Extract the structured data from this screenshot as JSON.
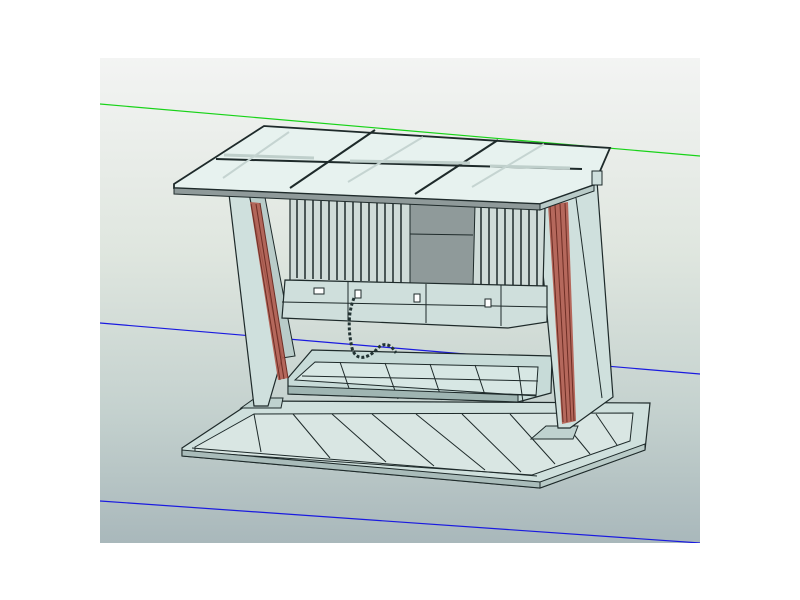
{
  "app": {
    "title": "",
    "view": {
      "background_top": "#f3f4f3",
      "background_bottom": "#a9b8bb",
      "axis_colors": {
        "x_axis": "#18d318",
        "y_axis": "#1a1ae0"
      },
      "model_colors": {
        "frame_fill": "#cfe0dd",
        "frame_stroke": "#1e2a2a",
        "insulator": "#b15b4e",
        "glass": "#e7f2ef",
        "dark_panel": "#8f9a9a"
      }
    },
    "model": {
      "name": "",
      "parts": [
        "roof-glass-panel",
        "left-column",
        "right-column",
        "radiator-fins",
        "control-console",
        "tray-frame",
        "base-frame",
        "cable"
      ]
    }
  }
}
